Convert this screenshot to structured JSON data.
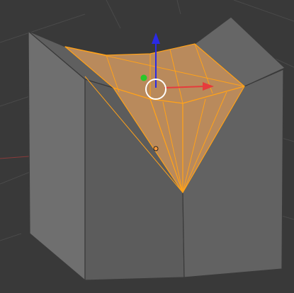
{
  "viewport": {
    "mode": "edit-mode",
    "object": "mesh-cube-with-inverted-pyramid-cavity",
    "background": "#393939",
    "grid_color": "#4a4a4a",
    "floor_x_axis_color": "#8b3a3a",
    "floor_y_axis_color": "#3f6a3f"
  },
  "mesh": {
    "face_colors": {
      "left_face": "#6f6f6f",
      "front_face": "#5c5c5c",
      "right_face": "#626262",
      "top_back_face": "#666666"
    },
    "edge_color": "#3a3a3a",
    "selection": {
      "fill": "#b98a5c",
      "edge": "#ffa21a",
      "selected_faces_label": "cavity-faces"
    }
  },
  "gizmo": {
    "type": "translate",
    "x_axis_color": "#e63c3c",
    "y_axis_color": "#28c828",
    "z_axis_color": "#2a2ae6",
    "center_ring_color": "#ffffff"
  },
  "origin": {
    "color": "#ff9a3c"
  }
}
